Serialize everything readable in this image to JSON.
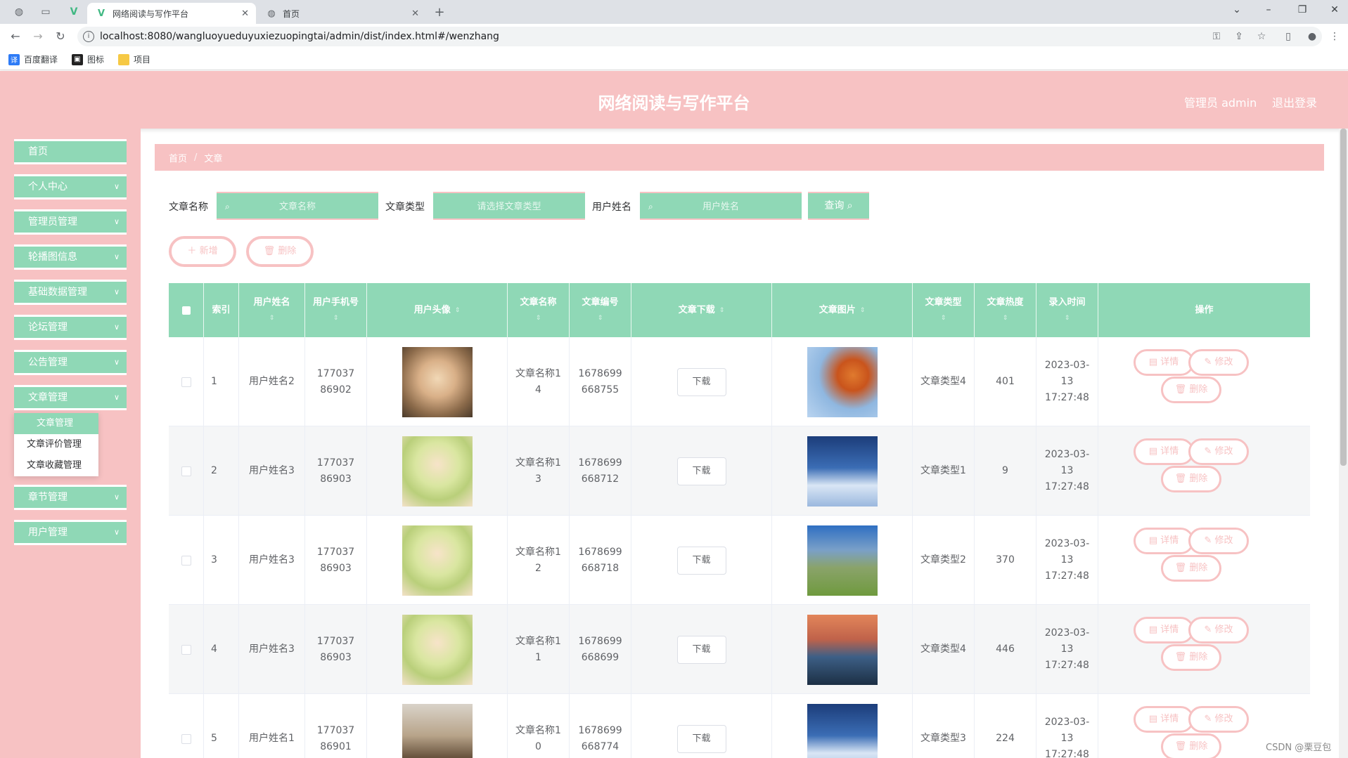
{
  "browser": {
    "tabs": [
      {
        "title": "网络阅读与写作平台",
        "active": true
      },
      {
        "title": "首页",
        "active": false
      }
    ],
    "url": "localhost:8080/wangluoyueduyuxiezuopingtai/admin/dist/index.html#/wenzhang",
    "bookmarks": [
      "百度翻译",
      "图标",
      "项目"
    ]
  },
  "header": {
    "title": "网络阅读与写作平台",
    "admin": "管理员 admin",
    "logout": "退出登录"
  },
  "sidebar": {
    "items": [
      {
        "label": "首页"
      },
      {
        "label": "个人中心"
      },
      {
        "label": "管理员管理"
      },
      {
        "label": "轮播图信息"
      },
      {
        "label": "基础数据管理"
      },
      {
        "label": "论坛管理"
      },
      {
        "label": "公告管理"
      },
      {
        "label": "文章管理"
      },
      {
        "label": "章节管理"
      },
      {
        "label": "用户管理"
      }
    ],
    "submenu": [
      "文章管理",
      "文章评价管理",
      "文章收藏管理"
    ]
  },
  "breadcrumb": {
    "home": "首页",
    "current": "文章"
  },
  "search": {
    "name_label": "文章名称",
    "name_placeholder": "文章名称",
    "type_label": "文章类型",
    "type_placeholder": "请选择文章类型",
    "user_label": "用户姓名",
    "user_placeholder": "用户姓名",
    "query": "查询"
  },
  "toolbar": {
    "add": "新增",
    "delete": "删除"
  },
  "table": {
    "headers": {
      "index": "索引",
      "username": "用户姓名",
      "phone": "用户手机号",
      "avatar": "用户头像",
      "name": "文章名称",
      "code": "文章编号",
      "download": "文章下载",
      "photo": "文章图片",
      "type": "文章类型",
      "heat": "文章热度",
      "time": "录入时间",
      "actions": "操作"
    },
    "download_btn": "下载",
    "detail_btn": "详情",
    "edit_btn": "修改",
    "delete_btn": "删除",
    "rows": [
      {
        "index": "1",
        "username": "用户姓名2",
        "phone": "17703786902",
        "name": "文章名称14",
        "code": "1678699668755",
        "type": "文章类型4",
        "heat": "401",
        "time": "2023-03-13 17:27:48"
      },
      {
        "index": "2",
        "username": "用户姓名3",
        "phone": "17703786903",
        "name": "文章名称13",
        "code": "1678699668712",
        "type": "文章类型1",
        "heat": "9",
        "time": "2023-03-13 17:27:48"
      },
      {
        "index": "3",
        "username": "用户姓名3",
        "phone": "17703786903",
        "name": "文章名称12",
        "code": "1678699668718",
        "type": "文章类型2",
        "heat": "370",
        "time": "2023-03-13 17:27:48"
      },
      {
        "index": "4",
        "username": "用户姓名3",
        "phone": "17703786903",
        "name": "文章名称11",
        "code": "1678699668699",
        "type": "文章类型4",
        "heat": "446",
        "time": "2023-03-13 17:27:48"
      },
      {
        "index": "5",
        "username": "用户姓名1",
        "phone": "17703786901",
        "name": "文章名称10",
        "code": "1678699668774",
        "type": "文章类型3",
        "heat": "224",
        "time": "2023-03-13 17:27:48"
      }
    ]
  },
  "watermark": "CSDN @栗豆包"
}
